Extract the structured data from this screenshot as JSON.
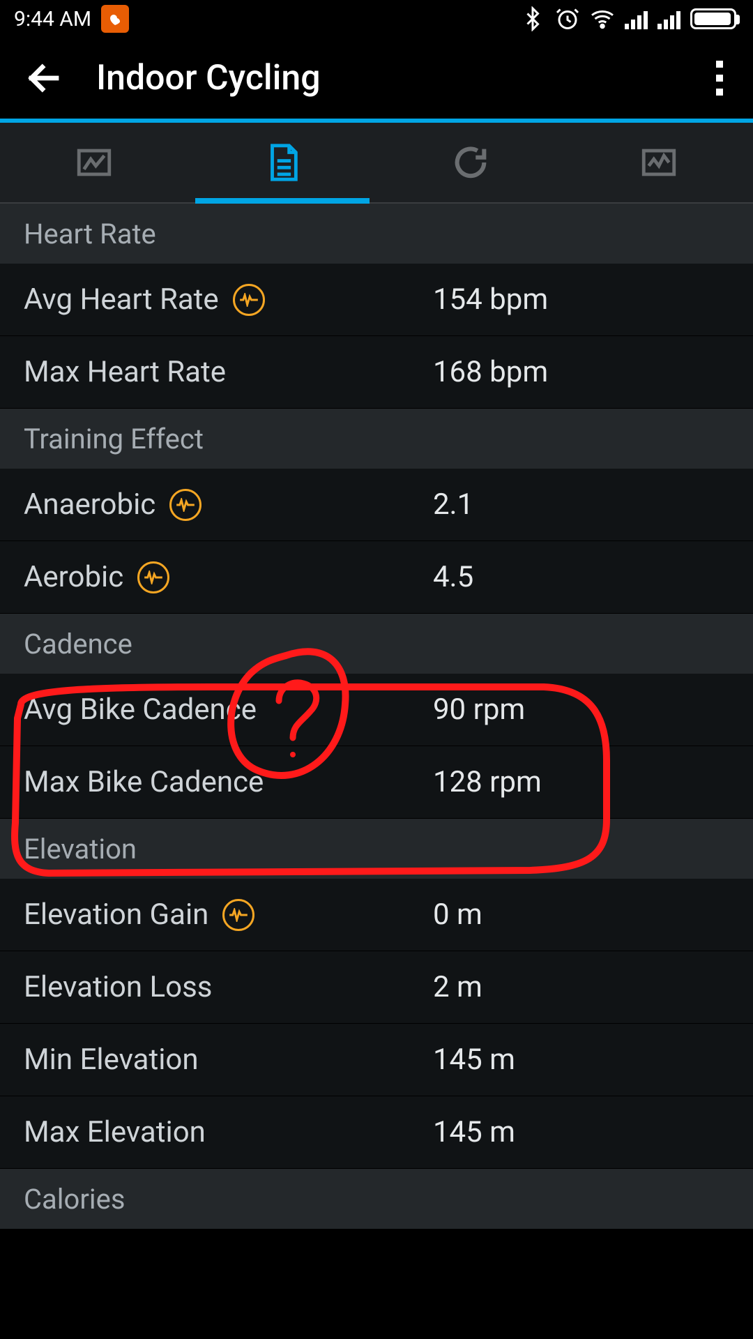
{
  "status": {
    "time": "9:44 AM"
  },
  "header": {
    "title": "Indoor Cycling"
  },
  "tabs": {
    "active_index": 1,
    "items": [
      {
        "name": "map"
      },
      {
        "name": "stats"
      },
      {
        "name": "laps"
      },
      {
        "name": "charts"
      }
    ]
  },
  "sections": [
    {
      "title": "Heart Rate",
      "rows": [
        {
          "label": "Avg Heart Rate",
          "value": "154 bpm",
          "icon": true
        },
        {
          "label": "Max Heart Rate",
          "value": "168 bpm",
          "icon": false
        }
      ]
    },
    {
      "title": "Training Effect",
      "rows": [
        {
          "label": "Anaerobic",
          "value": "2.1",
          "icon": true
        },
        {
          "label": "Aerobic",
          "value": "4.5",
          "icon": true
        }
      ]
    },
    {
      "title": "Cadence",
      "rows": [
        {
          "label": "Avg Bike Cadence",
          "value": "90 rpm",
          "icon": false
        },
        {
          "label": "Max Bike Cadence",
          "value": "128 rpm",
          "icon": false
        }
      ]
    },
    {
      "title": "Elevation",
      "rows": [
        {
          "label": "Elevation Gain",
          "value": "0 m",
          "icon": true
        },
        {
          "label": "Elevation Loss",
          "value": "2 m",
          "icon": false
        },
        {
          "label": "Min Elevation",
          "value": "145 m",
          "icon": false
        },
        {
          "label": "Max Elevation",
          "value": "145 m",
          "icon": false
        }
      ]
    },
    {
      "title": "Calories",
      "rows": []
    }
  ],
  "colors": {
    "accent": "#00a5e5",
    "orange": "#f5a623"
  }
}
